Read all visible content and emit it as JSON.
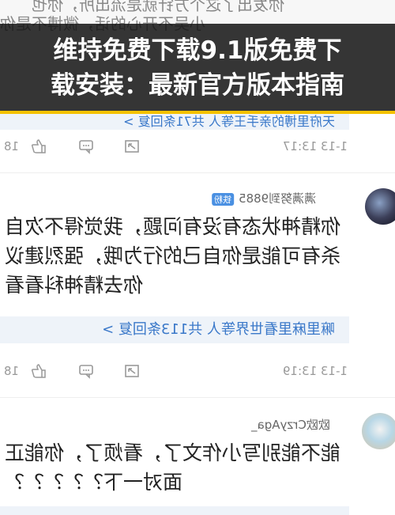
{
  "banner": {
    "line1": "维持免费下载9.1版免费下",
    "line2": "载安装：最新官方版本指南"
  },
  "top_residue": {
    "text1": "你发出了这个方针就是流出所，你也",
    "text2": "小吴不开心的话，微博不是你"
  },
  "first_thread": {
    "reply_bar": "天府里博的亲手王等人 共71条回复 >",
    "ops": {
      "time": "1-13 13:17",
      "share_count": "18",
      "like_count": "18"
    }
  },
  "comment1": {
    "username": "满满努到9885",
    "badge": "铁粉",
    "text": "你精神状态有没有问题，我觉得不次自杀有可能是你自己的行为哦，强烈建议你去精神科看看",
    "reply_bar": "嘛里麻里看世界等人 共113条回复 >",
    "ops": {
      "time": "1-13 13:19",
      "share_count": "18",
      "like_count": "18"
    }
  },
  "comment2": {
    "username": "欧欧CrzyAga_",
    "text": "能不能别写小作文了，看烦了，你能正面对一下？？？？？"
  },
  "colors": {
    "banner_bg": "#1a1a1a",
    "banner_border": "#f5c200",
    "link_blue": "#3a78c9",
    "reply_bg": "#eef3f9"
  }
}
